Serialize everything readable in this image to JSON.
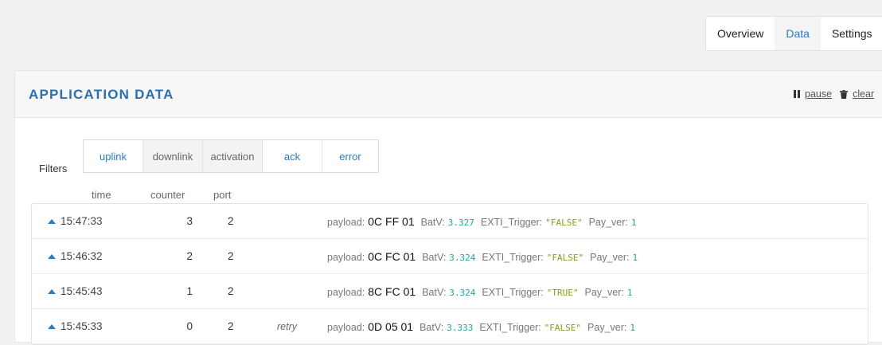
{
  "nav": {
    "tabs": [
      {
        "label": "Overview",
        "active": false
      },
      {
        "label": "Data",
        "active": true
      },
      {
        "label": "Settings",
        "active": false
      }
    ]
  },
  "card": {
    "title": "APPLICATION DATA",
    "actions": {
      "pause_label": "pause",
      "clear_label": "clear"
    }
  },
  "filters": {
    "label": "Filters",
    "buttons": [
      {
        "label": "uplink",
        "active": true
      },
      {
        "label": "downlink",
        "active": false
      },
      {
        "label": "activation",
        "active": false
      },
      {
        "label": "ack",
        "active": true
      },
      {
        "label": "error",
        "active": true
      }
    ]
  },
  "table": {
    "columns": {
      "time": "time",
      "counter": "counter",
      "port": "port"
    },
    "payload_key": "payload:",
    "rows": [
      {
        "time": "15:47:33",
        "counter": "3",
        "port": "2",
        "note": "",
        "payload": "0C FF 01",
        "fields": [
          {
            "key": "BatV:",
            "value": "3.327",
            "kind": "num"
          },
          {
            "key": "EXTI_Trigger:",
            "value": "\"FALSE\"",
            "kind": "str"
          },
          {
            "key": "Pay_ver:",
            "value": "1",
            "kind": "num"
          }
        ]
      },
      {
        "time": "15:46:32",
        "counter": "2",
        "port": "2",
        "note": "",
        "payload": "0C FC 01",
        "fields": [
          {
            "key": "BatV:",
            "value": "3.324",
            "kind": "num"
          },
          {
            "key": "EXTI_Trigger:",
            "value": "\"FALSE\"",
            "kind": "str"
          },
          {
            "key": "Pay_ver:",
            "value": "1",
            "kind": "num"
          }
        ]
      },
      {
        "time": "15:45:43",
        "counter": "1",
        "port": "2",
        "note": "",
        "payload": "8C FC 01",
        "fields": [
          {
            "key": "BatV:",
            "value": "3.324",
            "kind": "num"
          },
          {
            "key": "EXTI_Trigger:",
            "value": "\"TRUE\"",
            "kind": "str"
          },
          {
            "key": "Pay_ver:",
            "value": "1",
            "kind": "num"
          }
        ]
      },
      {
        "time": "15:45:33",
        "counter": "0",
        "port": "2",
        "note": "retry",
        "payload": "0D 05 01",
        "fields": [
          {
            "key": "BatV:",
            "value": "3.333",
            "kind": "num"
          },
          {
            "key": "EXTI_Trigger:",
            "value": "\"FALSE\"",
            "kind": "str"
          },
          {
            "key": "Pay_ver:",
            "value": "1",
            "kind": "num"
          }
        ]
      }
    ]
  }
}
